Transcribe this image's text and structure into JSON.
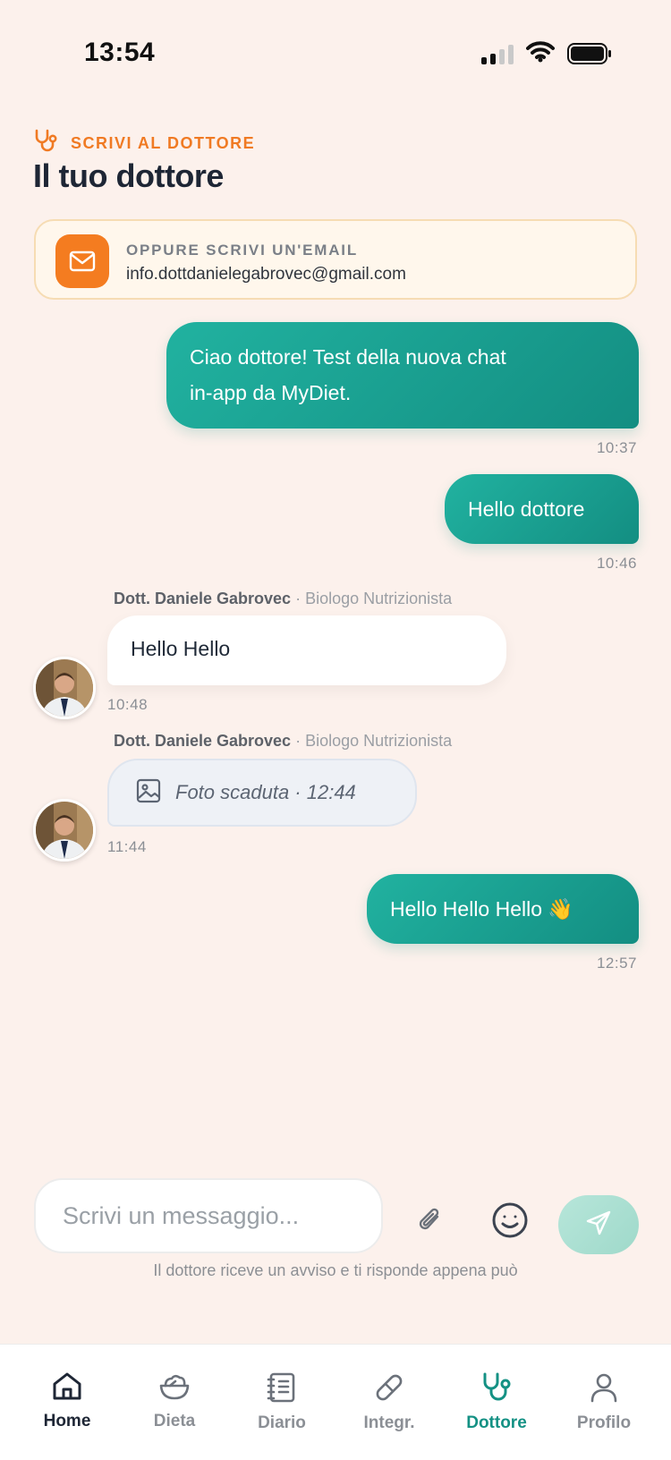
{
  "status_bar": {
    "time": "13:54"
  },
  "header": {
    "kicker": "SCRIVI AL DOTTORE",
    "title": "Il tuo dottore"
  },
  "email_card": {
    "kicker": "OPPURE SCRIVI UN'EMAIL",
    "address": "info.dottdanielegabrovec@gmail.com"
  },
  "messages": [
    {
      "direction": "out",
      "lines": [
        "Ciao dottore! Test della nuova chat",
        "in-app da MyDiet."
      ],
      "time": "10:37"
    },
    {
      "direction": "out",
      "text": "Hello dottore",
      "time": "10:46"
    },
    {
      "direction": "in",
      "sender_name": "Dott. Daniele Gabrovec",
      "sender_role": "· Biologo Nutrizionista",
      "text": "Hello Hello",
      "time": "10:48"
    },
    {
      "direction": "in",
      "sender_name": "Dott. Daniele Gabrovec",
      "sender_role": "· Biologo Nutrizionista",
      "text": "Foto scaduta · 12:44",
      "time": "11:44"
    },
    {
      "direction": "out",
      "text": "Hello Hello Hello 👋",
      "time": "12:57"
    }
  ],
  "composer": {
    "placeholder": "Scrivi un messaggio...",
    "hint": "Il dottore riceve un avviso e ti risponde appena può"
  },
  "nav": {
    "items": [
      {
        "label": "Home",
        "icon": "home-icon"
      },
      {
        "label": "Dieta",
        "icon": "salad-bowl-icon"
      },
      {
        "label": "Diario",
        "icon": "notebook-icon"
      },
      {
        "label": "Integr.",
        "icon": "pill-icon"
      },
      {
        "label": "Dottore",
        "icon": "stethoscope-icon",
        "active": true
      },
      {
        "label": "Profilo",
        "icon": "user-icon"
      }
    ]
  },
  "colors": {
    "accent": "#149184",
    "orange": "#f47c20",
    "background": "#fcf1ec"
  }
}
